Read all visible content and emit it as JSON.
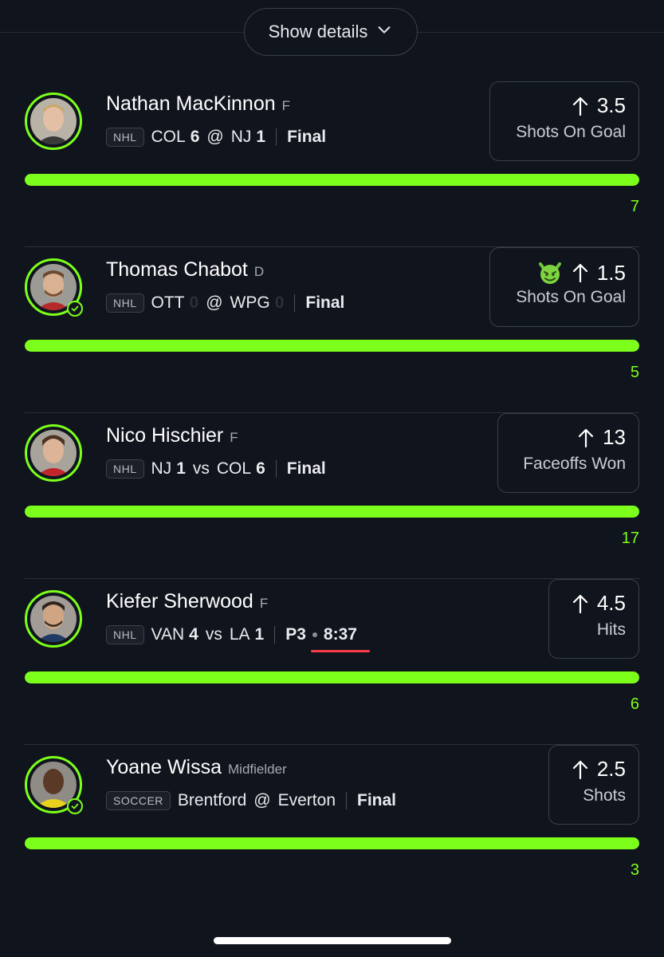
{
  "header": {
    "show_details_label": "Show details"
  },
  "picks": [
    {
      "name": "Nathan MacKinnon",
      "position": "F",
      "league": "NHL",
      "team1": "COL",
      "score1": "6",
      "connector": "@",
      "team2": "NJ",
      "score2": "1",
      "status": "Final",
      "verified": false,
      "line": "3.5",
      "stat": "Shots On Goal",
      "actual": "7",
      "progress": 1.0
    },
    {
      "name": "Thomas Chabot",
      "position": "D",
      "league": "NHL",
      "team1": "OTT",
      "score1": "0",
      "connector": "@",
      "team2": "WPG",
      "score2": "0",
      "status": "Final",
      "verified": true,
      "line": "1.5",
      "stat": "Shots On Goal",
      "actual": "5",
      "progress": 1.0
    },
    {
      "name": "Nico Hischier",
      "position": "F",
      "league": "NHL",
      "team1": "NJ",
      "score1": "1",
      "connector": "vs",
      "team2": "COL",
      "score2": "6",
      "status": "Final",
      "verified": false,
      "line": "13",
      "stat": "Faceoffs Won",
      "actual": "17",
      "progress": 1.0
    },
    {
      "name": "Kiefer Sherwood",
      "position": "F",
      "league": "NHL",
      "team1": "VAN",
      "score1": "4",
      "connector": "vs",
      "team2": "LA",
      "score2": "1",
      "period": "P3",
      "clock": "8:37",
      "verified": false,
      "line": "4.5",
      "stat": "Hits",
      "actual": "6",
      "progress": 1.0
    },
    {
      "name": "Yoane Wissa",
      "position": "Midfielder",
      "league": "SOCCER",
      "team1": "Brentford",
      "connector": "@",
      "team2": "Everton",
      "status": "Final",
      "verified": true,
      "line": "2.5",
      "stat": "Shots",
      "actual": "3",
      "progress": 1.0
    }
  ],
  "colors": {
    "background": "#10141d",
    "accent_green": "#7cff1a",
    "live_underline": "#ff3b4a"
  },
  "icons": [
    "chevron-down-icon",
    "arrow-up-icon",
    "check-icon",
    "devil-emoji-icon"
  ]
}
